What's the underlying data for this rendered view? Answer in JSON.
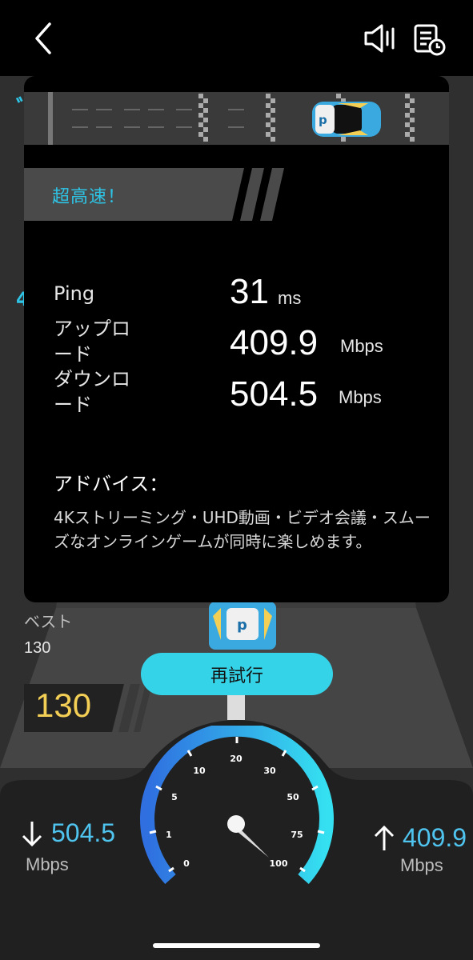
{
  "header": {
    "back_icon": "chevron-left-icon",
    "sound_icon": "speaker-icon",
    "history_icon": "history-clock-icon"
  },
  "result": {
    "rating": "超高速！",
    "ping": {
      "label": "Ping",
      "value": "31",
      "unit": "ms"
    },
    "upload": {
      "label_line1": "アップロ",
      "label_line2": "ード",
      "value": "409.9",
      "unit": "Mbps"
    },
    "download": {
      "label_line1": "ダウンロ",
      "label_line2": "ード",
      "value": "504.5",
      "unit": "Mbps"
    },
    "advice_title": "アドバイス：",
    "advice_text": "4Kストリーミング・UHD動画・ビデオ会議・スムーズなオンラインゲームが同時に楽しめます。"
  },
  "best": {
    "label": "ベスト",
    "value": "130"
  },
  "score": "130",
  "retry_label": "再試行",
  "dashboard": {
    "download_value": "504.5",
    "download_unit": "Mbps",
    "upload_value": "409.9",
    "upload_unit": "Mbps",
    "gauge_ticks": [
      "0",
      "1",
      "5",
      "10",
      "20",
      "30",
      "50",
      "75",
      "100"
    ]
  },
  "colors": {
    "accent": "#2ec4e6",
    "score": "#f4cf55",
    "retry": "#35d3e8"
  }
}
